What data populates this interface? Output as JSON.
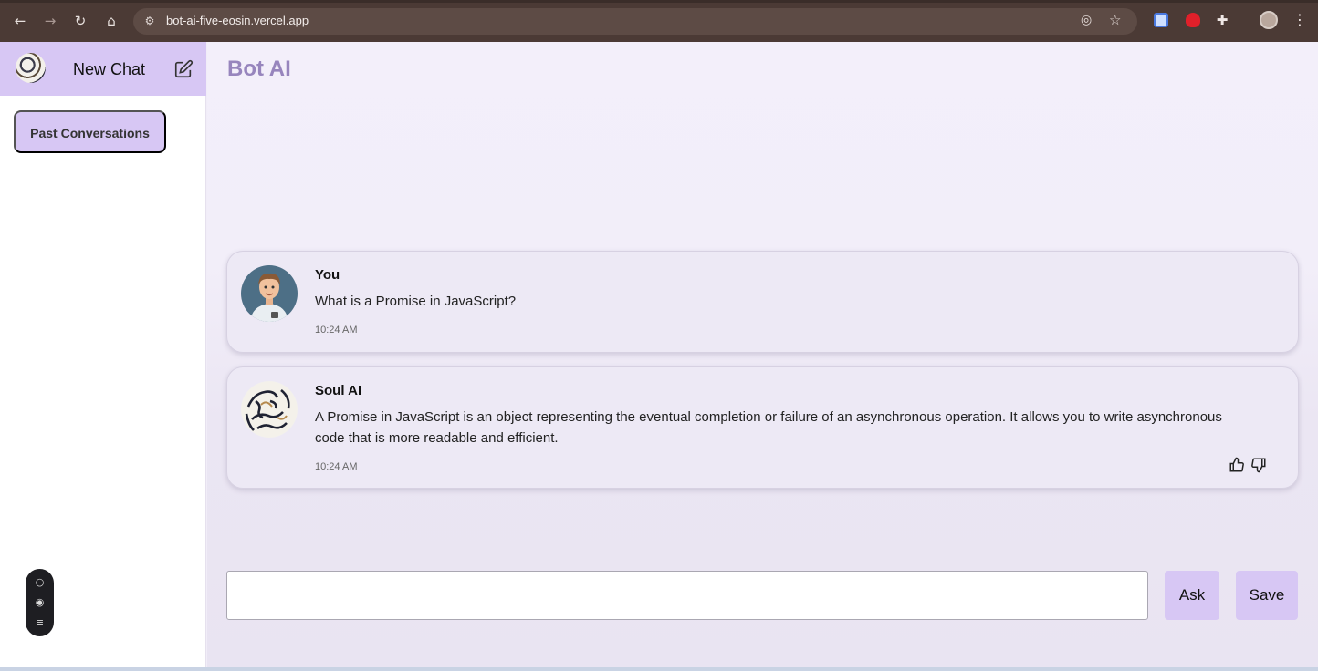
{
  "browser": {
    "url": "bot-ai-five-eosin.vercel.app"
  },
  "sidebar": {
    "new_chat_label": "New Chat",
    "past_conversations_label": "Past Conversations"
  },
  "main": {
    "title": "Bot AI",
    "messages": [
      {
        "sender": "You",
        "text": "What is a Promise in JavaScript?",
        "time": "10:24 AM"
      },
      {
        "sender": "Soul AI",
        "text": "A Promise in JavaScript is an object representing the eventual completion or failure of an asynchronous operation. It allows you to write asynchronous code that is more readable and efficient.",
        "time": "10:24 AM"
      }
    ],
    "input": {
      "value": "",
      "placeholder": ""
    },
    "ask_label": "Ask",
    "save_label": "Save"
  },
  "colors": {
    "accent": "#d7c7f4",
    "title": "#9785bd",
    "browser_chrome": "#4b3a35"
  }
}
